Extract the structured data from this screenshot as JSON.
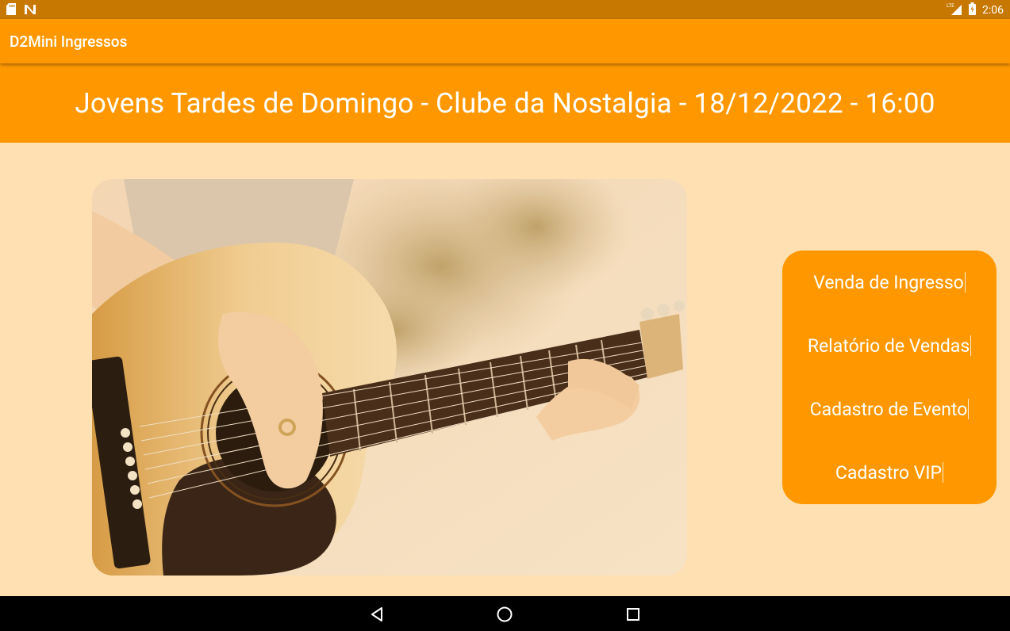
{
  "status_bar": {
    "time": "2:06",
    "icons": [
      "sd-card-icon",
      "n-notification-icon",
      "lte-signal-icon",
      "battery-icon"
    ]
  },
  "app_bar": {
    "title": "D2Mini Ingressos"
  },
  "event": {
    "title": "Jovens Tardes de Domingo - Clube da Nostalgia - 18/12/2022 - 16:00"
  },
  "photo": {
    "subject": "acoustic-guitar-photo"
  },
  "menu": {
    "items": [
      {
        "label": "Venda de Ingresso"
      },
      {
        "label": "Relatório de Vendas"
      },
      {
        "label": "Cadastro de Evento"
      },
      {
        "label": "Cadastro VIP"
      }
    ]
  },
  "nav_bar": {
    "icons": [
      "back-icon",
      "home-icon",
      "recents-icon"
    ]
  },
  "colors": {
    "primary": "#ff9800",
    "status_bar": "#c77800",
    "background": "#ffe0b2",
    "text_on_primary": "#ffffff"
  }
}
